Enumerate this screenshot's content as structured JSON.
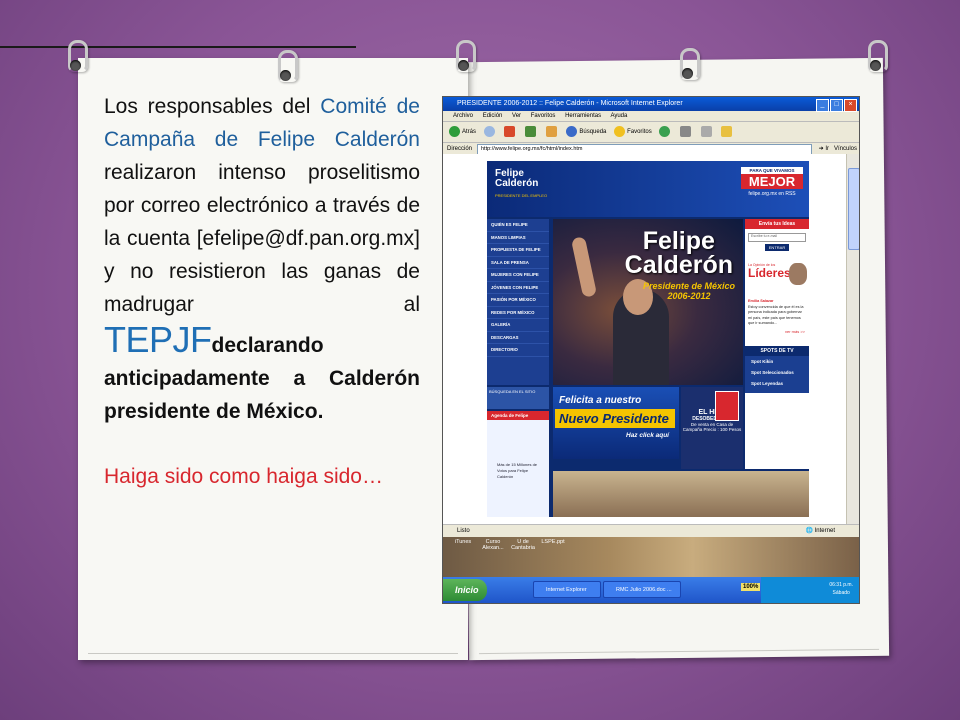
{
  "slide": {
    "text_segments": {
      "t1": "Los responsables del ",
      "t2": "Comité de Campaña de Felipe Calderón",
      "t3": " realizaron intenso proselitismo por correo electrónico a través de la cuenta [efelipe@df.pan.org.mx] y no resistieron las ganas de madrugar al ",
      "t4": "TEPJF",
      "t5": "declarando anticipadamente a Calderón presidente de México."
    },
    "closing_line": "Haiga sido como haiga sido…"
  },
  "colors": {
    "background": "#8a5596",
    "accent_blue": "#1f6fb5",
    "accent_red": "#d8272e"
  },
  "browser": {
    "window_title": "PRESIDENTE 2006-2012 :: Felipe Calderón - Microsoft Internet Explorer",
    "menu": [
      "Archivo",
      "Edición",
      "Ver",
      "Favoritos",
      "Herramientas",
      "Ayuda"
    ],
    "toolbar": {
      "back": "Atrás",
      "search": "Búsqueda",
      "favorites": "Favoritos"
    },
    "address_label": "Dirección",
    "address_value": "http://www.felipe.org.mx/fc/html/index.htm",
    "go_label": "Ir",
    "links_label": "Vínculos",
    "status_left": "Listo",
    "status_right": "Internet"
  },
  "website": {
    "logo_line1": "Felipe",
    "logo_line2": "Calderón",
    "logo_tagline": "PRESIDENTE DEL EMPLEO",
    "promo_top": "PARA QUE VIVAMOS",
    "promo_main": "MEJOR",
    "promo_url": "felipe.org.mx en RSS",
    "nav": [
      "QUIÉN ES FELIPE",
      "MANOS LIMPIAS",
      "PROPUESTA DE FELIPE",
      "SALA DE PRENSA",
      "MUJERES CON FELIPE",
      "JÓVENES CON FELIPE",
      "PASIÓN POR MÉXICO",
      "REDES POR MÉXICO",
      "GALERÍA",
      "DESCARGAS",
      "DIRECTORIO"
    ],
    "search_label": "BÚSQUEDA EN EL SITIO",
    "agenda_label": "Agenda de Felipe",
    "agenda_text": "Más de 15 Millones de Votos para Felipe Calderón",
    "hero_name_1": "Felipe",
    "hero_name_2": "Calderón",
    "hero_subtitle_1": "Presidente de México",
    "hero_subtitle_2": "2006-2012",
    "banner_line1": "Felicita a nuestro",
    "banner_line2": "Nuevo Presidente",
    "banner_cta": "Haz click aquí",
    "book_title_1": "EL HIJO",
    "book_title_2": "DESOBEDIENTE",
    "book_text": "De venta en Casa de Campaña Precio : 100 Pesos",
    "envia_header": "Envía tus Ideas",
    "email_placeholder": "Escribe tu e-mail",
    "entrar_label": "ENTRAR",
    "opinion_label": "La Opinión de los",
    "lideres_label": "Líderes",
    "quote_name": "Emilia Salazar",
    "quote_text": "Estoy convencida de que él es la persona indicada para gobernar mi país, este país que tenemos que ir sumando...",
    "ver_mas": "ver más >>",
    "spots_header": "SPOTS DE TV",
    "spots": [
      "Spot Kikin",
      "Spot Seleccionados",
      "Spot Leyendas"
    ]
  },
  "desktop": {
    "icons": [
      "iTunes",
      "Curso Alexan...",
      "U de Cantabria",
      "LSPE.ppt"
    ]
  },
  "taskbar": {
    "start_label": "Inicio",
    "tasks": [
      "Internet Explorer",
      "RMC Julio 2006.doc ..."
    ],
    "battery": "100%",
    "clock_time": "06:31 p.m.",
    "clock_day": "Sábado"
  }
}
